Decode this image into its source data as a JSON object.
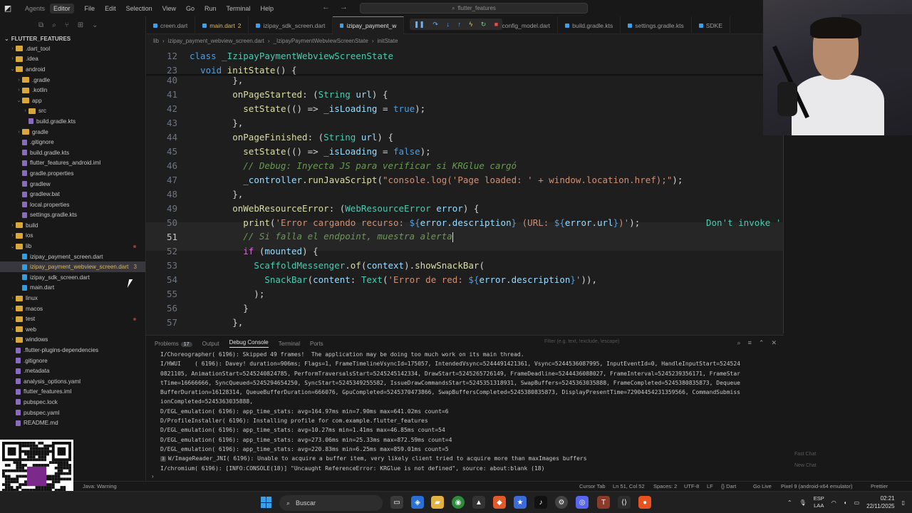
{
  "titlebar": {
    "modes": [
      "Agents",
      "Editor"
    ],
    "menus": [
      "File",
      "Edit",
      "Selection",
      "View",
      "Go",
      "Run",
      "Terminal",
      "Help"
    ],
    "search_placeholder": "flutter_features"
  },
  "sidebar": {
    "title": "FLUTTER_FEATURES",
    "items": [
      {
        "label": ".dart_tool",
        "depth": 1,
        "kind": "folder",
        "open": false
      },
      {
        "label": ".idea",
        "depth": 1,
        "kind": "folder",
        "open": false
      },
      {
        "label": "android",
        "depth": 1,
        "kind": "folder",
        "open": true
      },
      {
        "label": ".gradle",
        "depth": 2,
        "kind": "folder",
        "open": false
      },
      {
        "label": ".kotlin",
        "depth": 2,
        "kind": "folder",
        "open": false
      },
      {
        "label": "app",
        "depth": 2,
        "kind": "folder",
        "open": true
      },
      {
        "label": "src",
        "depth": 3,
        "kind": "folder",
        "open": false
      },
      {
        "label": "build.gradle.kts",
        "depth": 3,
        "kind": "file"
      },
      {
        "label": "gradle",
        "depth": 2,
        "kind": "folder",
        "open": false
      },
      {
        "label": ".gitignore",
        "depth": 2,
        "kind": "file"
      },
      {
        "label": "build.gradle.kts",
        "depth": 2,
        "kind": "file"
      },
      {
        "label": "flutter_features_android.iml",
        "depth": 2,
        "kind": "file"
      },
      {
        "label": "gradle.properties",
        "depth": 2,
        "kind": "file"
      },
      {
        "label": "gradlew",
        "depth": 2,
        "kind": "file"
      },
      {
        "label": "gradlew.bat",
        "depth": 2,
        "kind": "file"
      },
      {
        "label": "local.properties",
        "depth": 2,
        "kind": "file"
      },
      {
        "label": "settings.gradle.kts",
        "depth": 2,
        "kind": "file"
      },
      {
        "label": "build",
        "depth": 1,
        "kind": "folder",
        "open": false
      },
      {
        "label": "ios",
        "depth": 1,
        "kind": "folder",
        "open": false
      },
      {
        "label": "lib",
        "depth": 1,
        "kind": "folder",
        "open": true,
        "dot": true
      },
      {
        "label": "izipay_payment_screen.dart",
        "depth": 2,
        "kind": "dart"
      },
      {
        "label": "izipay_payment_webview_screen.dart",
        "depth": 2,
        "kind": "dart",
        "selected": true,
        "badge": "3"
      },
      {
        "label": "izipay_sdk_screen.dart",
        "depth": 2,
        "kind": "dart"
      },
      {
        "label": "main.dart",
        "depth": 2,
        "kind": "dart"
      },
      {
        "label": "linux",
        "depth": 1,
        "kind": "folder",
        "open": false
      },
      {
        "label": "macos",
        "depth": 1,
        "kind": "folder",
        "open": false
      },
      {
        "label": "test",
        "depth": 1,
        "kind": "folder",
        "open": false,
        "dot": true
      },
      {
        "label": "web",
        "depth": 1,
        "kind": "folder",
        "open": false
      },
      {
        "label": "windows",
        "depth": 1,
        "kind": "folder",
        "open": false
      },
      {
        "label": ".flutter-plugins-dependencies",
        "depth": 1,
        "kind": "file"
      },
      {
        "label": ".gitignore",
        "depth": 1,
        "kind": "file"
      },
      {
        "label": ".metadata",
        "depth": 1,
        "kind": "file"
      },
      {
        "label": "analysis_options.yaml",
        "depth": 1,
        "kind": "file"
      },
      {
        "label": "flutter_features.iml",
        "depth": 1,
        "kind": "file"
      },
      {
        "label": "pubspec.lock",
        "depth": 1,
        "kind": "file"
      },
      {
        "label": "pubspec.yaml",
        "depth": 1,
        "kind": "file"
      },
      {
        "label": "README.md",
        "depth": 1,
        "kind": "file"
      }
    ]
  },
  "tabs": [
    {
      "label": "creen.dart",
      "active": false
    },
    {
      "label": "main.dart",
      "suffix": "2",
      "active": false,
      "modified": true
    },
    {
      "label": "izipay_sdk_screen.dart",
      "active": false
    },
    {
      "label": "izipay_payment_w",
      "active": true
    },
    {
      "label": "t_config_model.dart",
      "active": false
    },
    {
      "label": "build.gradle.kts",
      "active": false
    },
    {
      "label": "settings.gradle.kts",
      "active": false
    },
    {
      "label": "SDKE",
      "active": false
    }
  ],
  "breadcrumb": [
    "lib",
    "izipay_payment_webview_screen.dart",
    "_IzipayPaymentWebviewScreenState",
    "initState"
  ],
  "editor": {
    "sticky": [
      {
        "ln": "12",
        "tokens": [
          [
            "k",
            "class "
          ],
          [
            "c",
            "_IzipayPaymentWebviewScreenState"
          ]
        ]
      },
      {
        "ln": "23",
        "tokens": [
          [
            "p",
            "  "
          ],
          [
            "k",
            "void "
          ],
          [
            "f",
            "initState"
          ],
          [
            "p",
            "() {"
          ]
        ]
      }
    ],
    "lines": [
      {
        "ln": "40",
        "tokens": [
          [
            "p",
            "        },"
          ]
        ]
      },
      {
        "ln": "41",
        "tokens": [
          [
            "p",
            "        "
          ],
          [
            "f",
            "onPageStarted"
          ],
          [
            "p",
            ": ("
          ],
          [
            "c",
            "String "
          ],
          [
            "v",
            "url"
          ],
          [
            "p",
            ") {"
          ]
        ]
      },
      {
        "ln": "42",
        "tokens": [
          [
            "p",
            "          "
          ],
          [
            "f",
            "setState"
          ],
          [
            "p",
            "(() => "
          ],
          [
            "v",
            "_isLoading"
          ],
          [
            "p",
            " = "
          ],
          [
            "k",
            "true"
          ],
          [
            "p",
            ");"
          ]
        ]
      },
      {
        "ln": "43",
        "tokens": [
          [
            "p",
            "        },"
          ]
        ]
      },
      {
        "ln": "44",
        "tokens": [
          [
            "p",
            "        "
          ],
          [
            "f",
            "onPageFinished"
          ],
          [
            "p",
            ": ("
          ],
          [
            "c",
            "String "
          ],
          [
            "v",
            "url"
          ],
          [
            "p",
            ") {"
          ]
        ]
      },
      {
        "ln": "45",
        "tokens": [
          [
            "p",
            "          "
          ],
          [
            "f",
            "setState"
          ],
          [
            "p",
            "(() => "
          ],
          [
            "v",
            "_isLoading"
          ],
          [
            "p",
            " = "
          ],
          [
            "k",
            "false"
          ],
          [
            "p",
            ");"
          ]
        ]
      },
      {
        "ln": "46",
        "tokens": [
          [
            "cm",
            "          // Debug: Inyecta JS para verificar si KRGlue cargó"
          ]
        ]
      },
      {
        "ln": "47",
        "tokens": [
          [
            "p",
            "          "
          ],
          [
            "v",
            "_controller"
          ],
          [
            "p",
            "."
          ],
          [
            "f",
            "runJavaScript"
          ],
          [
            "p",
            "("
          ],
          [
            "s",
            "\"console.log('Page loaded: ' + window.location.href);\""
          ],
          [
            "p",
            ");"
          ]
        ]
      },
      {
        "ln": "48",
        "tokens": [
          [
            "p",
            "        },"
          ]
        ]
      },
      {
        "ln": "49",
        "tokens": [
          [
            "p",
            "        "
          ],
          [
            "f",
            "onWebResourceError"
          ],
          [
            "p",
            ": ("
          ],
          [
            "c",
            "WebResourceError "
          ],
          [
            "v",
            "error"
          ],
          [
            "p",
            ") {"
          ]
        ]
      },
      {
        "ln": "50",
        "tokens": [
          [
            "p",
            "          "
          ],
          [
            "f",
            "print"
          ],
          [
            "p",
            "("
          ],
          [
            "s",
            "'Error cargando recurso: "
          ],
          [
            "k",
            "${"
          ],
          [
            "v",
            "error.description"
          ],
          [
            "k",
            "}"
          ],
          [
            "s",
            " (URL: "
          ],
          [
            "k",
            "${"
          ],
          [
            "v",
            "error.url"
          ],
          [
            "k",
            "}"
          ],
          [
            "s",
            ")'"
          ],
          [
            "p",
            ");"
          ]
        ],
        "hint": "Don't invoke '"
      },
      {
        "ln": "51",
        "tokens": [
          [
            "cm",
            "          // Si falla el endpoint, muestra alerta"
          ]
        ],
        "current": true
      },
      {
        "ln": "52",
        "tokens": [
          [
            "p",
            "          "
          ],
          [
            "pk",
            "if "
          ],
          [
            "p",
            "("
          ],
          [
            "v",
            "mounted"
          ],
          [
            "p",
            ") {"
          ]
        ]
      },
      {
        "ln": "53",
        "tokens": [
          [
            "p",
            "            "
          ],
          [
            "c",
            "ScaffoldMessenger"
          ],
          [
            "p",
            "."
          ],
          [
            "f",
            "of"
          ],
          [
            "p",
            "("
          ],
          [
            "v",
            "context"
          ],
          [
            "p",
            ")."
          ],
          [
            "f",
            "showSnackBar"
          ],
          [
            "p",
            "("
          ]
        ]
      },
      {
        "ln": "54",
        "tokens": [
          [
            "p",
            "              "
          ],
          [
            "c",
            "SnackBar"
          ],
          [
            "p",
            "("
          ],
          [
            "v",
            "content"
          ],
          [
            "p",
            ": "
          ],
          [
            "c",
            "Text"
          ],
          [
            "p",
            "("
          ],
          [
            "s",
            "'Error de red: "
          ],
          [
            "k",
            "${"
          ],
          [
            "v",
            "error.description"
          ],
          [
            "k",
            "}"
          ],
          [
            "s",
            "'"
          ],
          [
            "p",
            ")),"
          ]
        ]
      },
      {
        "ln": "55",
        "tokens": [
          [
            "p",
            "            );"
          ]
        ]
      },
      {
        "ln": "56",
        "tokens": [
          [
            "p",
            "          }"
          ]
        ]
      },
      {
        "ln": "57",
        "tokens": [
          [
            "p",
            "        },"
          ]
        ]
      }
    ]
  },
  "panel": {
    "tabs": [
      {
        "label": "Problems",
        "count": "17"
      },
      {
        "label": "Output"
      },
      {
        "label": "Debug Console",
        "active": true
      },
      {
        "label": "Terminal"
      },
      {
        "label": "Ports"
      }
    ],
    "filter_placeholder": "Filter (e.g. text, !exclude, \\escape)",
    "console": [
      "I/Choreographer( 6196): Skipped 49 frames!  The application may be doing too much work on its main thread.",
      "I/HWUI    ( 6196): Davey! duration=906ms; Flags=1, FrameTimelineVsyncId=175057, IntendedVsync=5244491421361, Vsync=5244536087995, InputEventId=0, HandleInputStart=524524",
      "0821105, AnimationStart=5245240824785, PerformTraversalsStart=5245245142334, DrawStart=5245265726149, FrameDeadline=5244436088027, FrameInterval=5245239356171, FrameStar",
      "tTime=16666666, SyncQueued=5245294654250, SyncStart=5245349255582, IssueDrawCommandsStart=5245351318931, SwapBuffers=5245363035888, FrameCompleted=5245380835873, Dequeue",
      "BufferDuration=16128314, QueueBufferDuration=666076, GpuCompleted=5245370473866, SwapBuffersCompleted=5245380835873, DisplayPresentTime=72904454231359566, CommandSubmiss",
      "ionCompleted=5245363035888,",
      "D/EGL_emulation( 6196): app_time_stats: avg=164.97ms min=7.90ms max=641.02ms count=6",
      "D/ProfileInstaller( 6196): Installing profile for com.example.flutter_features",
      "D/EGL_emulation( 6196): app_time_stats: avg=10.27ms min=1.41ms max=46.85ms count=54",
      "D/EGL_emulation( 6196): app_time_stats: avg=273.06ms min=25.33ms max=872.59ms count=4",
      "D/EGL_emulation( 6196): app_time_stats: avg=220.83ms min=6.25ms max=859.01ms count=5",
      "W/ImageReader_JNI( 6196): Unable to acquire a buffer item, very likely client tried to acquire more than maxImages buffers",
      "I/chromium( 6196): [INFO:CONSOLE(18)] \"Uncaught ReferenceError: KRGlue is not defined\", source: about:blank (18)"
    ]
  },
  "right_hints": [
    "Fast Chat",
    "New Chat"
  ],
  "statusbar": {
    "left": "Java: Warning",
    "items": [
      "Cursor Tab",
      "Ln 51, Col 52",
      "Spaces: 2",
      "UTF-8",
      "LF",
      "{} Dart",
      "Go Live",
      "Pixel 9 (android-x64 emulator)",
      "Prettier"
    ]
  },
  "taskbar": {
    "search_label": "Buscar",
    "lang_top": "ESP",
    "lang_bottom": "LAA",
    "time": "02:21",
    "date": "22/11/2025"
  },
  "colors": {
    "accent": "#3794ff",
    "editor_bg": "#1e1e1e",
    "sidebar_bg": "#181818"
  }
}
